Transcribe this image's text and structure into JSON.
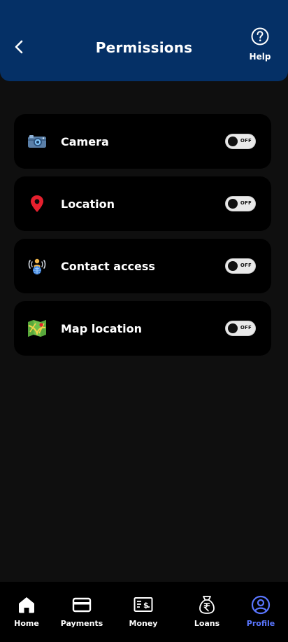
{
  "header": {
    "title": "Permissions",
    "help_label": "Help",
    "bg_color": "#053066"
  },
  "permissions": [
    {
      "label": "Camera",
      "icon": "camera-icon",
      "state": "OFF"
    },
    {
      "label": "Location",
      "icon": "location-pin-icon",
      "state": "OFF"
    },
    {
      "label": "Contact access",
      "icon": "contact-access-icon",
      "state": "OFF"
    },
    {
      "label": "Map location",
      "icon": "map-icon",
      "state": "OFF"
    }
  ],
  "nav": {
    "items": [
      {
        "label": "Home",
        "icon": "home-icon",
        "active": false
      },
      {
        "label": "Payments",
        "icon": "card-icon",
        "active": false
      },
      {
        "label": "Money",
        "icon": "money-icon",
        "active": false
      },
      {
        "label": "Loans",
        "icon": "rupee-bag-icon",
        "active": false
      },
      {
        "label": "Profile",
        "icon": "profile-icon",
        "active": true
      }
    ],
    "active_color": "#5a76ff"
  }
}
